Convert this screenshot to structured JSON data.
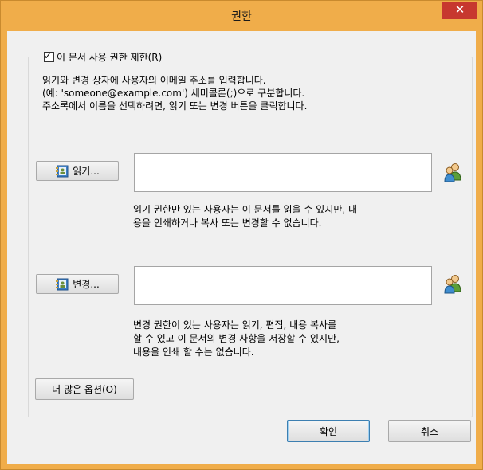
{
  "window": {
    "title": "권한",
    "close_glyph": "✕"
  },
  "restrict_checkbox": {
    "label": "이 문서 사용 권한 제한(R)",
    "checked": true,
    "check_glyph": "✓"
  },
  "description": [
    "읽기와 변경 상자에 사용자의 이메일 주소를 입력합니다.",
    "(예: 'someone@example.com') 세미콜론(;)으로 구분합니다.",
    "주소록에서 이름을 선택하려면, 읽기 또는 변경 버튼을 클릭합니다."
  ],
  "read": {
    "button_label": "읽기...",
    "input_value": "",
    "help": [
      "읽기 권한만 있는 사용자는 이 문서를 읽을 수 있지만, 내",
      "용을 인쇄하거나 복사 또는 변경할 수 없습니다."
    ]
  },
  "change": {
    "button_label": "변경...",
    "input_value": "",
    "help": [
      "변경 권한이 있는 사용자는 읽기, 편집, 내용 복사를",
      "할 수 있고 이 문서의 변경 사항을 저장할 수 있지만,",
      "내용을 인쇄 할 수는 없습니다."
    ]
  },
  "more_options_label": "더 많은 옵션(O)",
  "ok_label": "확인",
  "cancel_label": "취소",
  "colors": {
    "title_bar": "#f0ad4a",
    "close_button": "#c7382f",
    "dialog_bg": "#f0f0f0"
  }
}
